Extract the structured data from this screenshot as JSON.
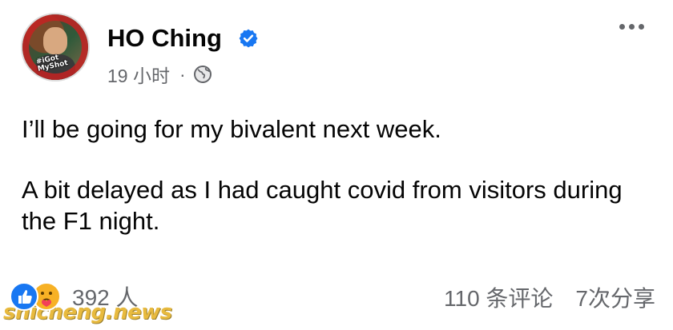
{
  "post": {
    "author": "HO Ching",
    "verified": true,
    "timestamp": "19 小时",
    "separator": "·",
    "visibility_icon": "globe-icon",
    "avatar_badge": "#iGot\nMyShot",
    "body": [
      "I’ll be going for my bivalent next week.",
      "A bit delayed as I had caught covid from visitors during the F1 night."
    ],
    "reactions": {
      "icons": [
        "like-icon",
        "care-icon"
      ],
      "count": "392 人"
    },
    "comments": "110 条评论",
    "shares": "7次分享"
  },
  "watermark": "shicheng.news",
  "colors": {
    "secondary_text": "#65676b",
    "verified_blue": "#1877f2",
    "like_blue": "#1877f2",
    "care_yellow": "#f7b125",
    "watermark_gold": "#e5ae1d"
  }
}
